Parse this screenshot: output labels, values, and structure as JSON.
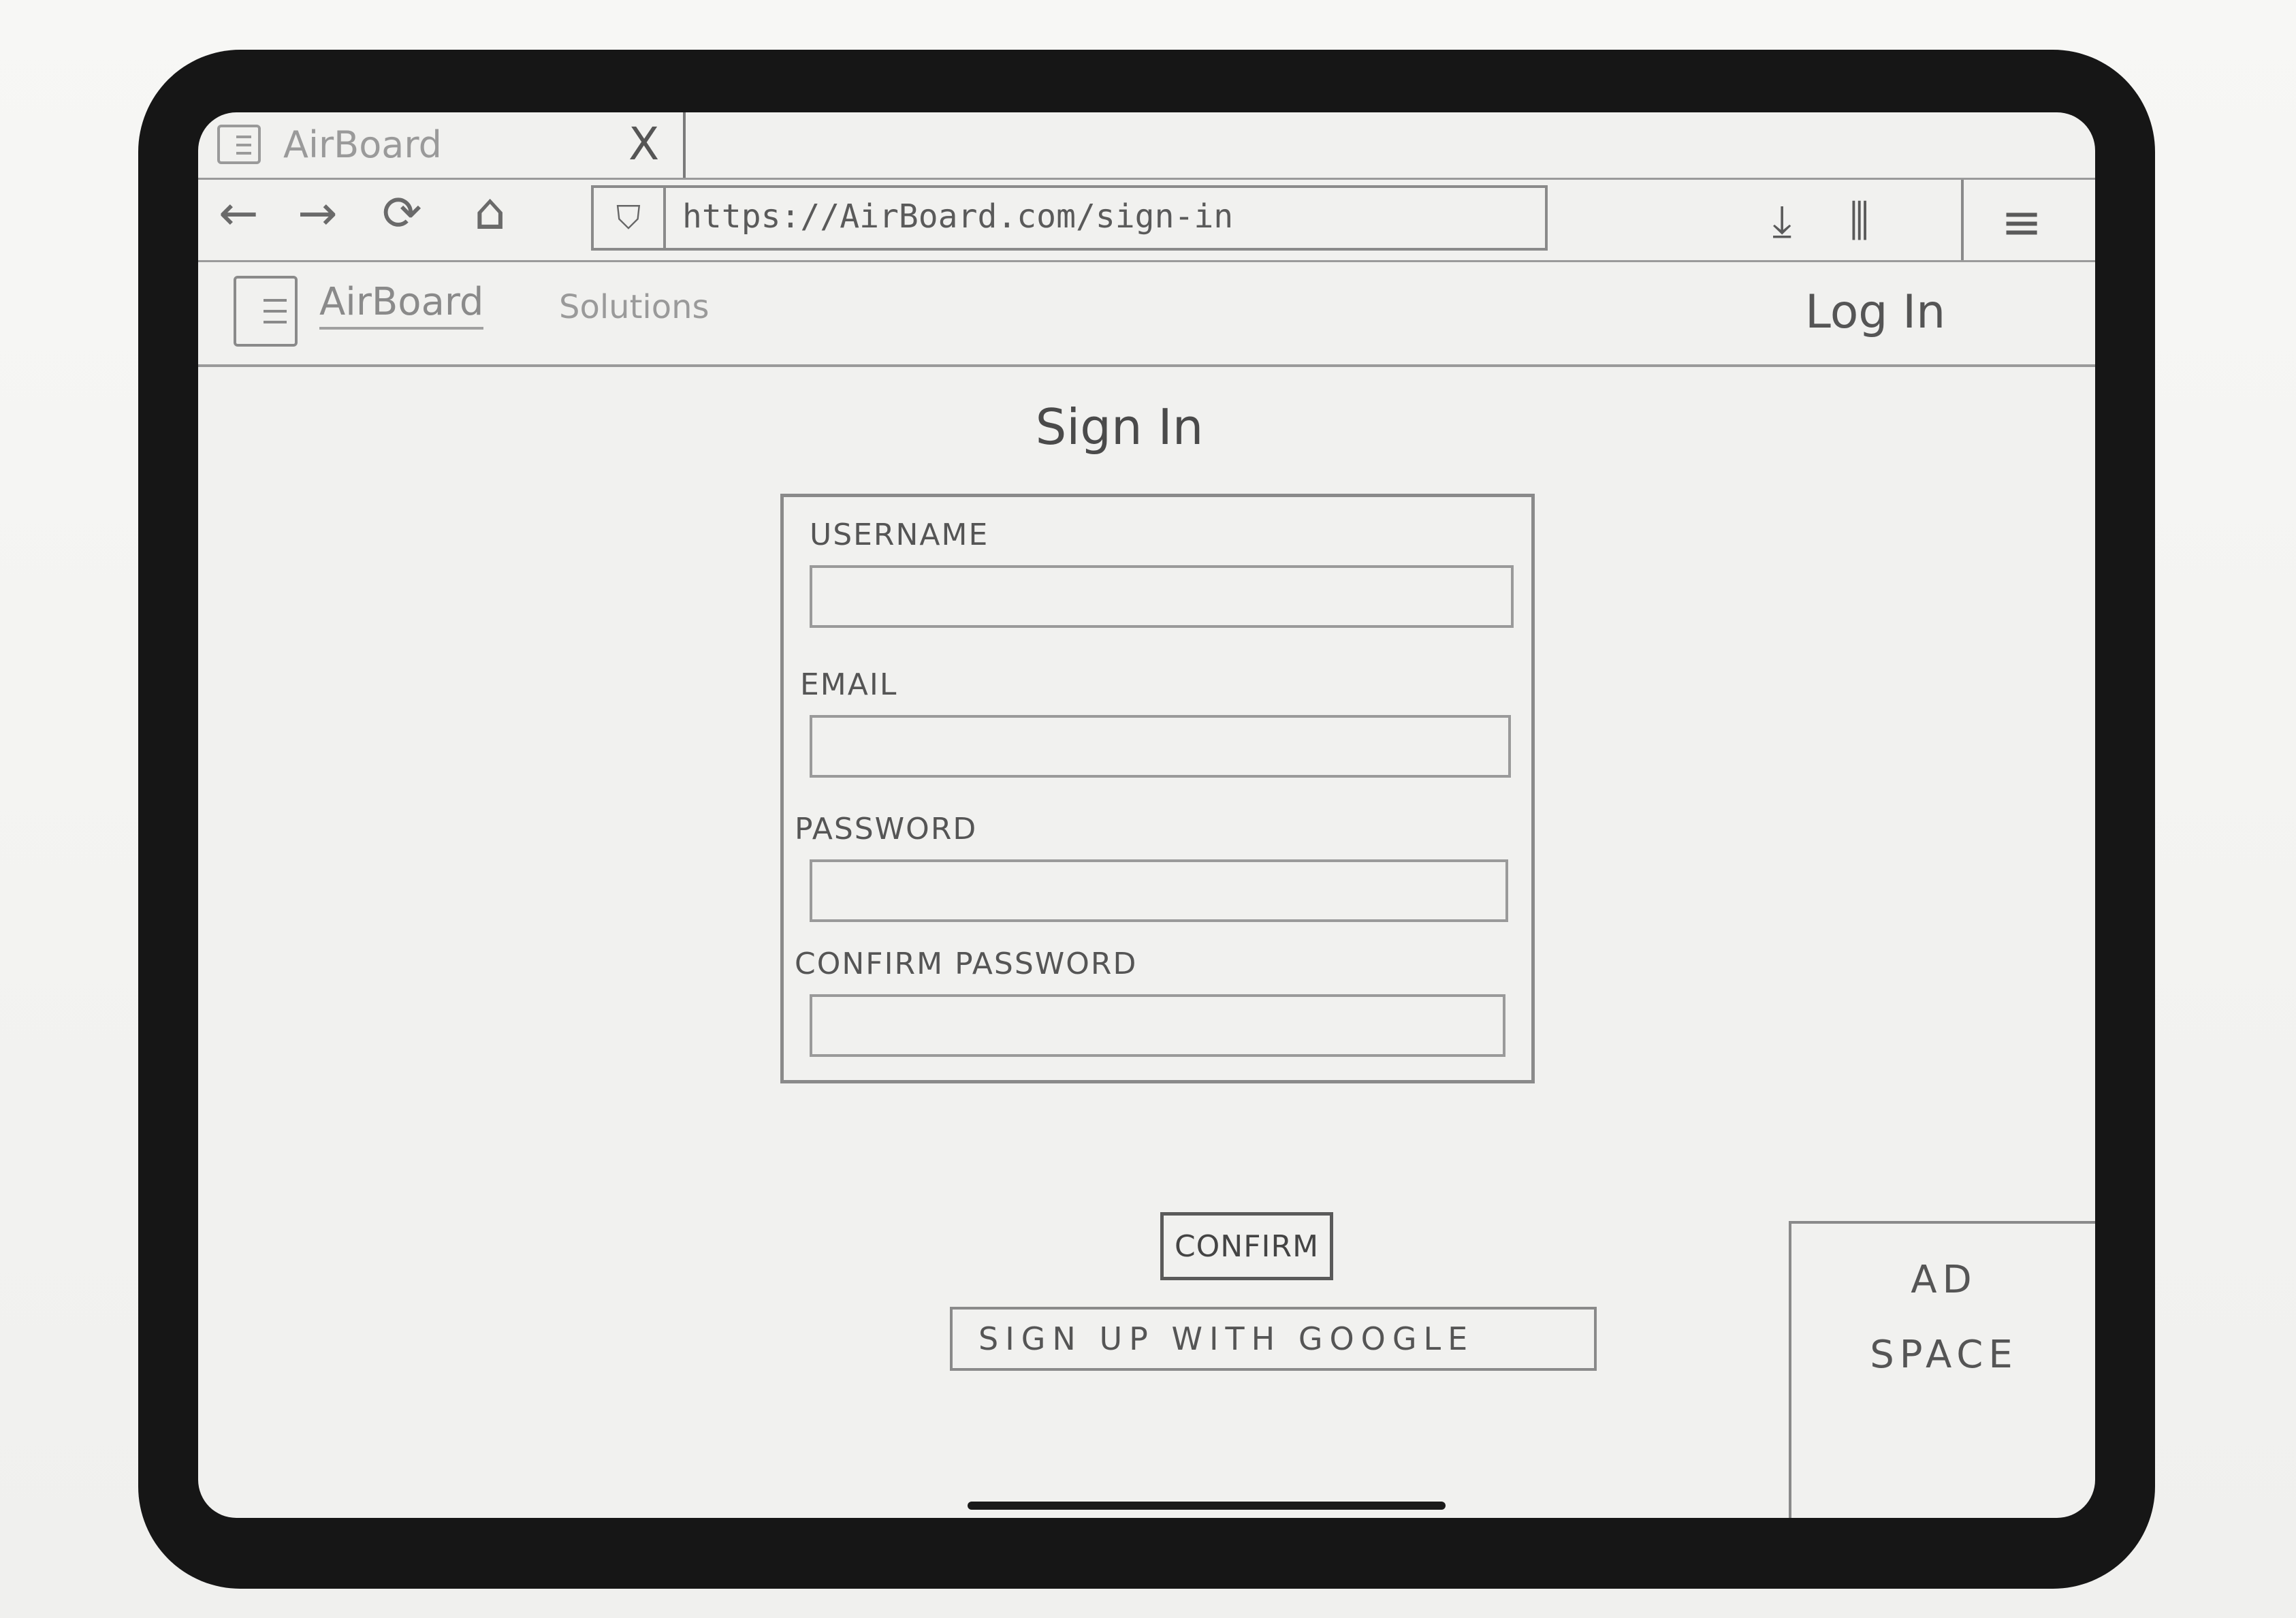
{
  "browser": {
    "tab_title": "AirBoard",
    "tab_close": "X",
    "url": "https://AirBoard.com/sign-in",
    "icons": [
      "back-arrow-icon",
      "forward-arrow-icon",
      "reload-icon",
      "home-icon",
      "shield-icon",
      "download-icon",
      "library-icon",
      "menu-icon"
    ]
  },
  "site": {
    "name": "AirBoard",
    "nav_solutions": "Solutions",
    "login_link": "Log In"
  },
  "page": {
    "heading": "Sign In"
  },
  "form": {
    "username_label": "USERNAME",
    "email_label": "EMAIL",
    "password_label": "PASSWORD",
    "confirm_password_label": "CONFIRM PASSWORD",
    "username_value": "",
    "email_value": "",
    "password_value": "",
    "confirm_password_value": ""
  },
  "actions": {
    "confirm_label": "CONFIRM",
    "google_label": "SIGN UP WITH GOOGLE"
  },
  "ad": {
    "line1": "AD",
    "line2": "SPACE"
  }
}
